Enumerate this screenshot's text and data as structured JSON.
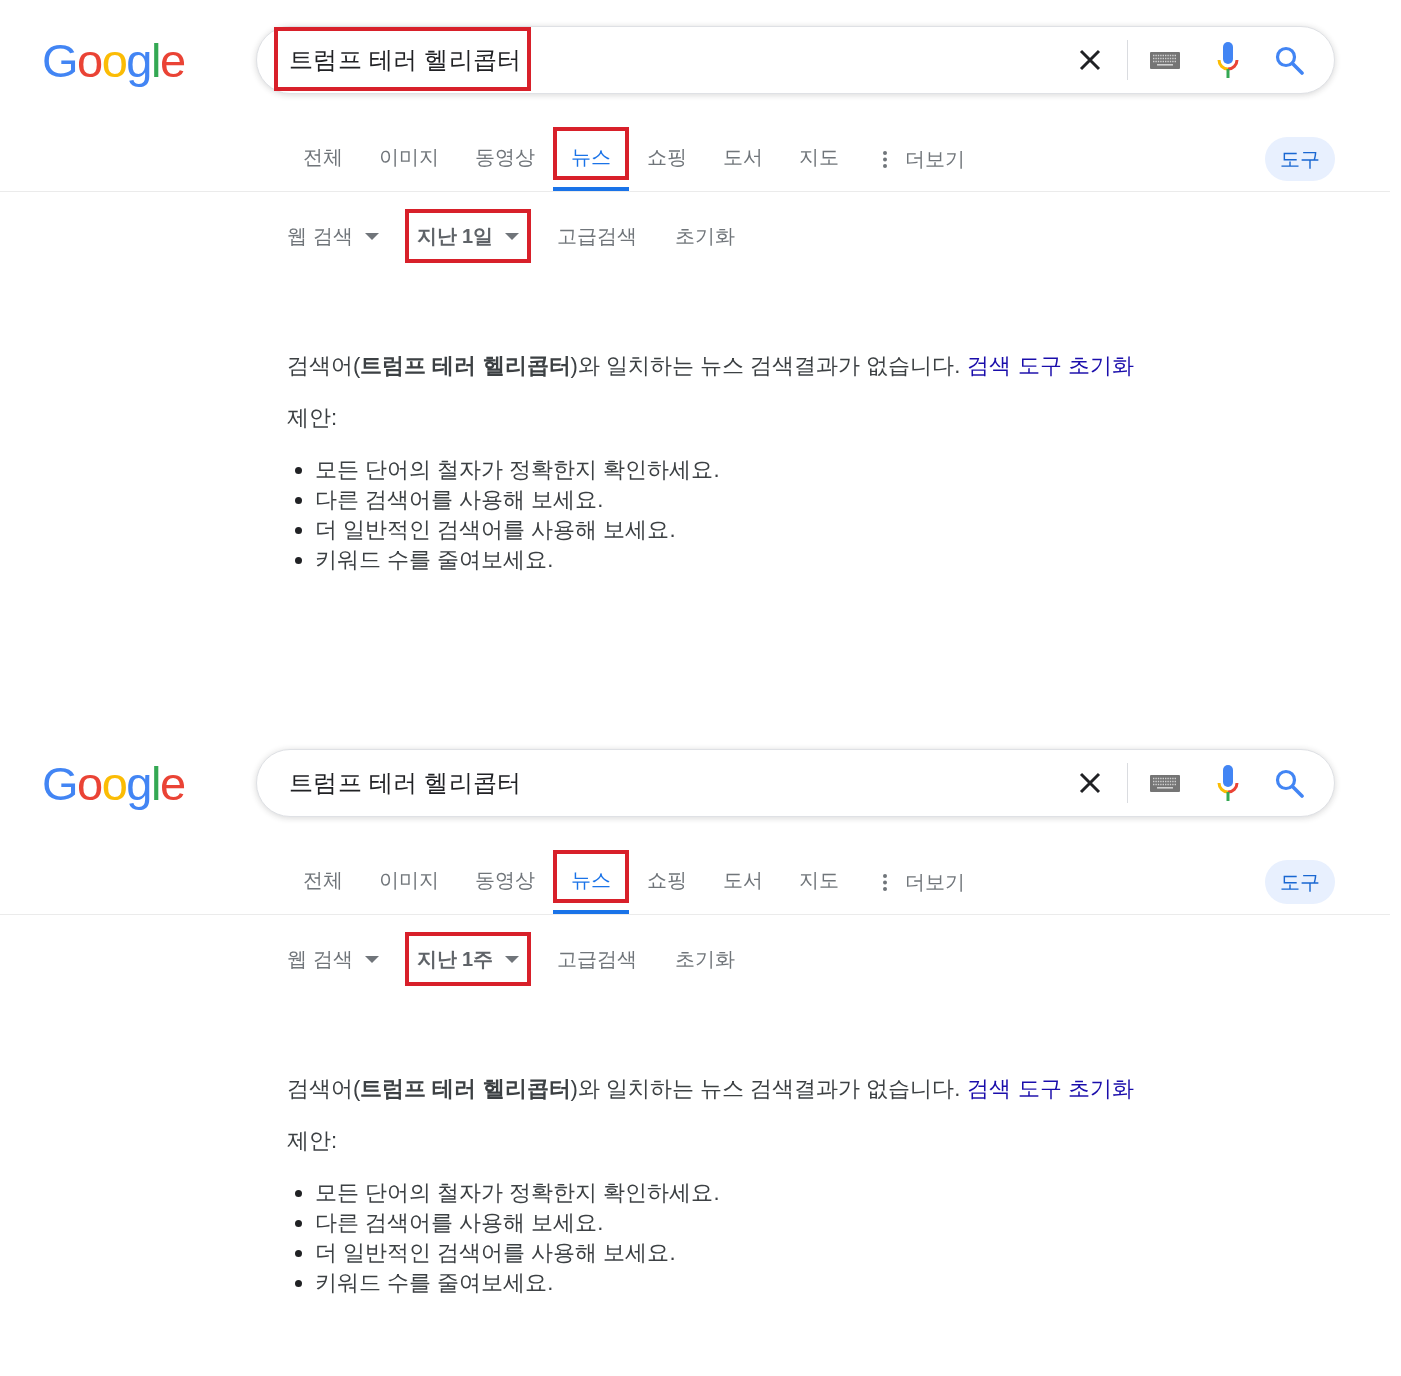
{
  "panels": [
    {
      "logo": "Google",
      "search": {
        "query": "트럼프 테러 헬리콥터",
        "highlighted": true
      },
      "tabs": [
        {
          "label": "전체",
          "selected": false,
          "highlighted": false
        },
        {
          "label": "이미지",
          "selected": false,
          "highlighted": false
        },
        {
          "label": "동영상",
          "selected": false,
          "highlighted": false
        },
        {
          "label": "뉴스",
          "selected": true,
          "highlighted": true
        },
        {
          "label": "쇼핑",
          "selected": false,
          "highlighted": false
        },
        {
          "label": "도서",
          "selected": false,
          "highlighted": false
        },
        {
          "label": "지도",
          "selected": false,
          "highlighted": false
        }
      ],
      "more_menu": {
        "label": "더보기"
      },
      "tools_button": {
        "label": "도구"
      },
      "filters": [
        {
          "kind": "dropdown",
          "label": "웹 검색",
          "active": false,
          "highlighted": false
        },
        {
          "kind": "dropdown",
          "label": "지난 1일",
          "active": true,
          "highlighted": true
        },
        {
          "kind": "link",
          "label": "고급검색",
          "active": false,
          "highlighted": false
        },
        {
          "kind": "link",
          "label": "초기화",
          "active": false,
          "highlighted": false
        }
      ],
      "message": {
        "text": "검색어(**트럼프 테러 헬리콥터**)와 일치하는 뉴스 검색결과가 없습니다.",
        "link": "검색 도구 초기화"
      },
      "suggestions_label": "제안:",
      "suggestions": [
        "모든 단어의 철자가 정확한지 확인하세요.",
        "다른 검색어를 사용해 보세요.",
        "더 일반적인 검색어를 사용해 보세요.",
        "키워드 수를 줄여보세요."
      ]
    },
    {
      "logo": "Google",
      "search": {
        "query": "트럼프 테러 헬리콥터",
        "highlighted": false
      },
      "tabs": [
        {
          "label": "전체",
          "selected": false,
          "highlighted": false
        },
        {
          "label": "이미지",
          "selected": false,
          "highlighted": false
        },
        {
          "label": "동영상",
          "selected": false,
          "highlighted": false
        },
        {
          "label": "뉴스",
          "selected": true,
          "highlighted": true
        },
        {
          "label": "쇼핑",
          "selected": false,
          "highlighted": false
        },
        {
          "label": "도서",
          "selected": false,
          "highlighted": false
        },
        {
          "label": "지도",
          "selected": false,
          "highlighted": false
        }
      ],
      "more_menu": {
        "label": "더보기"
      },
      "tools_button": {
        "label": "도구"
      },
      "filters": [
        {
          "kind": "dropdown",
          "label": "웹 검색",
          "active": false,
          "highlighted": false
        },
        {
          "kind": "dropdown",
          "label": "지난 1주",
          "active": true,
          "highlighted": true
        },
        {
          "kind": "link",
          "label": "고급검색",
          "active": false,
          "highlighted": false
        },
        {
          "kind": "link",
          "label": "초기화",
          "active": false,
          "highlighted": false
        }
      ],
      "message": {
        "text": "검색어(**트럼프 테러 헬리콥터**)와 일치하는 뉴스 검색결과가 없습니다.",
        "link": "검색 도구 초기화"
      },
      "suggestions_label": "제안:",
      "suggestions": [
        "모든 단어의 철자가 정확한지 확인하세요.",
        "다른 검색어를 사용해 보세요.",
        "더 일반적인 검색어를 사용해 보세요.",
        "키워드 수를 줄여보세요."
      ]
    }
  ]
}
